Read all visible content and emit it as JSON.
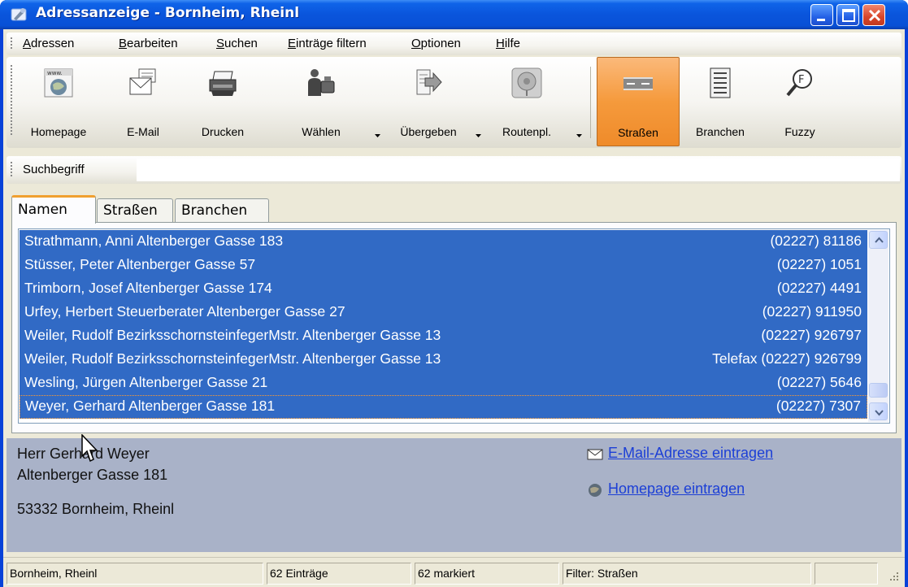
{
  "window": {
    "title": "Adressanzeige - Bornheim, Rheinl",
    "colors": {
      "titlebar": "#0a55dc",
      "selection": "#316ac5",
      "details_bg": "#a9b2c8",
      "active_tool": "#f59a3c",
      "link": "#1c3fd6"
    }
  },
  "menu": {
    "items": [
      {
        "label": "Adressen"
      },
      {
        "label": "Bearbeiten"
      },
      {
        "label": "Suchen"
      },
      {
        "label": "Einträge filtern"
      },
      {
        "label": "Optionen"
      },
      {
        "label": "Hilfe"
      }
    ]
  },
  "toolbar": {
    "buttons": [
      {
        "label": "Homepage",
        "icon": "www-globe-icon"
      },
      {
        "label": "E-Mail",
        "icon": "envelope-icon"
      },
      {
        "label": "Drucken",
        "icon": "printer-icon"
      },
      {
        "label": "Wählen",
        "icon": "phone-dial-icon",
        "dropdown": true
      },
      {
        "label": "Übergeben",
        "icon": "export-arrow-icon",
        "dropdown": true
      },
      {
        "label": "Routenpl.",
        "icon": "route-map-icon",
        "dropdown": true
      },
      {
        "label": "Straßen",
        "icon": "street-icon",
        "active": true
      },
      {
        "label": "Branchen",
        "icon": "list-icon"
      },
      {
        "label": "Fuzzy",
        "icon": "magnifier-f-icon"
      }
    ]
  },
  "search": {
    "label": "Suchbegriff",
    "value": ""
  },
  "tabs": [
    {
      "label": "Namen",
      "active": true
    },
    {
      "label": "Straßen",
      "active": false
    },
    {
      "label": "Branchen",
      "active": false
    }
  ],
  "list": {
    "rows": [
      {
        "name": "Strathmann, Anni Altenberger Gasse 183",
        "phone": "(02227) 81186"
      },
      {
        "name": "Stüsser, Peter Altenberger Gasse 57",
        "phone": "(02227) 1051"
      },
      {
        "name": "Trimborn, Josef Altenberger Gasse 174",
        "phone": "(02227) 4491"
      },
      {
        "name": "Urfey, Herbert Steuerberater Altenberger Gasse 27",
        "phone": "(02227) 911950"
      },
      {
        "name": "Weiler, Rudolf BezirksschornsteinfegerMstr. Altenberger Gasse 13",
        "phone": "(02227) 926797"
      },
      {
        "name": "Weiler, Rudolf BezirksschornsteinfegerMstr. Altenberger Gasse 13",
        "phone": "Telefax (02227) 926799"
      },
      {
        "name": "Wesling, Jürgen Altenberger Gasse 21",
        "phone": "(02227) 5646"
      },
      {
        "name": "Weyer, Gerhard Altenberger Gasse 181",
        "phone": "(02227) 7307"
      }
    ]
  },
  "details": {
    "name": "Herr Gerhard Weyer",
    "street": "Altenberger Gasse 181",
    "city": "53332 Bornheim, Rheinl",
    "email_link": "E-Mail-Adresse eintragen",
    "homepage_link": "Homepage eintragen"
  },
  "status": {
    "place": "Bornheim, Rheinl",
    "entries": "62 Einträge",
    "marked": "62 markiert",
    "filter": "Filter: Straßen",
    "extra": ""
  }
}
